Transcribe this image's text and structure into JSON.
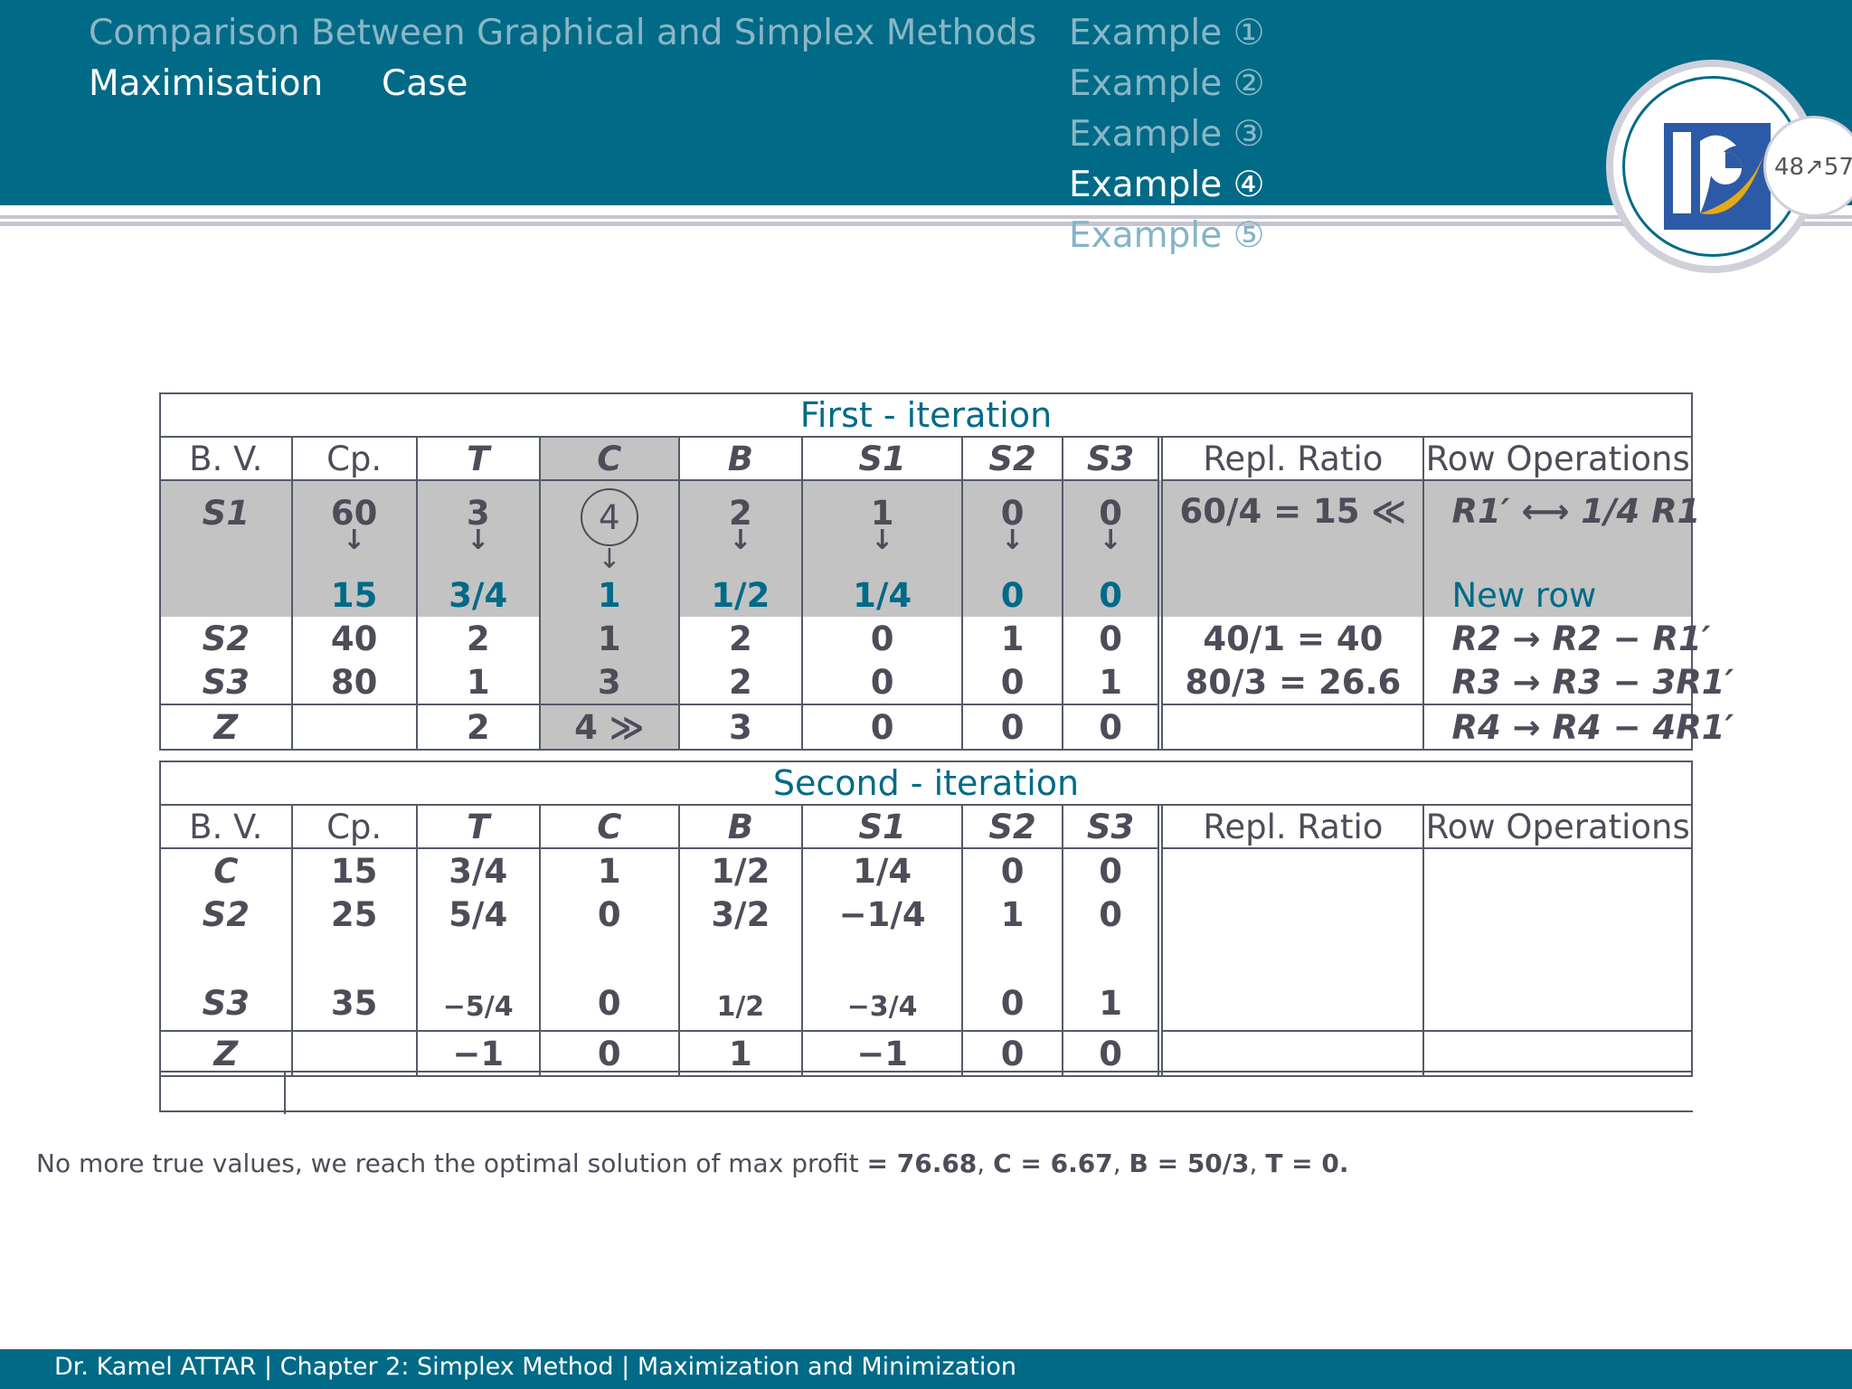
{
  "header": {
    "section_title": "Comparison Between Graphical and Simplex Methods",
    "subsection_a": "Maximisation",
    "subsection_b": "Case",
    "examples": [
      "Example ①",
      "Example ②",
      "Example ③",
      "Example ④",
      "Example ⑤"
    ],
    "active_example": 3,
    "page_indicator": "48↗57"
  },
  "first_iteration": {
    "title": "First - iteration",
    "headers": [
      "B. V.",
      "Cp.",
      "T",
      "C",
      "B",
      "S1",
      "S2",
      "S3",
      "Repl. Ratio",
      "Row Operations"
    ],
    "pivot_row": {
      "bv": "S1",
      "original": [
        "60",
        "3",
        "4",
        "2",
        "1",
        "0",
        "0"
      ],
      "arrow": "↓",
      "new": [
        "15",
        "3/4",
        "1",
        "1/2",
        "1/4",
        "0",
        "0"
      ],
      "ratio": "60/4 = 15 ≪",
      "operation": "R1′ ⟷ 1/4 R1",
      "new_row_label": "New row"
    },
    "rows": [
      {
        "bv": "S2",
        "values": [
          "40",
          "2",
          "1",
          "2",
          "0",
          "1",
          "0"
        ],
        "ratio": "40/1 = 40",
        "operation": "R2 → R2 − R1′"
      },
      {
        "bv": "S3",
        "values": [
          "80",
          "1",
          "3",
          "2",
          "0",
          "0",
          "1"
        ],
        "ratio": "80/3 = 26.6",
        "operation": "R3 → R3 − 3R1′"
      }
    ],
    "z_row": {
      "bv": "Z",
      "values": [
        "",
        "2",
        "4 ≫",
        "3",
        "0",
        "0",
        "0"
      ],
      "ratio": "",
      "operation": "R4 → R4 − 4R1′"
    }
  },
  "second_iteration": {
    "title": "Second - iteration",
    "headers": [
      "B. V.",
      "Cp.",
      "T",
      "C",
      "B",
      "S1",
      "S2",
      "S3",
      "Repl. Ratio",
      "Row Operations"
    ],
    "rows": [
      {
        "bv": "C",
        "values": [
          "15",
          "3/4",
          "1",
          "1/2",
          "1/4",
          "0",
          "0"
        ]
      },
      {
        "bv": "S2",
        "values": [
          "25",
          "5/4",
          "0",
          "3/2",
          "−1/4",
          "1",
          "0"
        ]
      },
      {
        "bv": "S3",
        "values": [
          "35",
          "−5/4",
          "0",
          "1/2",
          "−3/4",
          "0",
          "1"
        ]
      }
    ],
    "z_row": {
      "bv": "Z",
      "values": [
        "",
        "−1",
        "0",
        "1",
        "−1",
        "0",
        "0"
      ]
    }
  },
  "conclusion": {
    "text": "No more true values, we reach the optimal solution of max profit",
    "max_profit": "= 76.68",
    "c_value": "C = 6.67",
    "b_value": "B = 50/3",
    "t_value": "T = 0."
  },
  "footer": {
    "text": "Dr. Kamel ATTAR | Chapter 2: Simplex Method | Maximization and Minimization"
  },
  "colors": {
    "header_bg": "#006a87",
    "accent": "#006a87",
    "shade": "#c3c3c3"
  }
}
